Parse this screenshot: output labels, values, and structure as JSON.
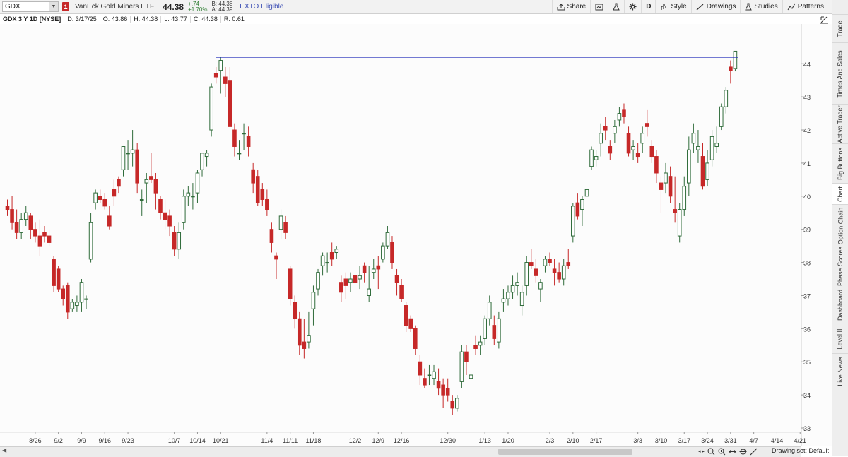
{
  "header": {
    "symbol": "GDX",
    "flag": "1",
    "description": "VanEck Gold Miners ETF",
    "price": "44.38",
    "change": "+.74",
    "change_pct": "+1.70%",
    "bid": "B: 44.38",
    "ask": "A: 44.39",
    "exto": "EXTO Eligible"
  },
  "toolbar": {
    "share": "Share",
    "period": "D",
    "style": "Style",
    "drawings": "Drawings",
    "studies": "Studies",
    "patterns": "Patterns"
  },
  "infobar": {
    "symbol": "GDX 3 Y 1D [NYSE]",
    "date": "D: 3/17/25",
    "open": "O: 43.86",
    "high": "H: 44.38",
    "low": "L: 43.77",
    "close": "C: 44.38",
    "range": "R: 0.61"
  },
  "right_tabs": [
    "Trade",
    "Times And Sales",
    "Active Trader",
    "Big Buttons",
    "Chart",
    "Option Chain",
    "Phase Scores",
    "Dashboard",
    "Level II",
    "Live News"
  ],
  "active_tab": "Chart",
  "bottom": {
    "drawing_set": "Drawing set: Default"
  },
  "colors": {
    "up": "#2f6b3a",
    "down": "#c62828",
    "hline": "#1f2bb8",
    "accent": "#3f51b5"
  },
  "chart_data": {
    "type": "candlestick",
    "ylim": [
      33,
      45.2
    ],
    "y_ticks": [
      33,
      34,
      35,
      36,
      37,
      38,
      39,
      40,
      41,
      42,
      43,
      44
    ],
    "x_ticks": [
      {
        "label": "8/26",
        "i": 6
      },
      {
        "label": "9/2",
        "i": 11
      },
      {
        "label": "9/9",
        "i": 16
      },
      {
        "label": "9/16",
        "i": 21
      },
      {
        "label": "9/23",
        "i": 26
      },
      {
        "label": "10/7",
        "i": 36
      },
      {
        "label": "10/14",
        "i": 41
      },
      {
        "label": "10/21",
        "i": 46
      },
      {
        "label": "11/4",
        "i": 56
      },
      {
        "label": "11/11",
        "i": 61
      },
      {
        "label": "11/18",
        "i": 66
      },
      {
        "label": "12/2",
        "i": 75
      },
      {
        "label": "12/9",
        "i": 80
      },
      {
        "label": "12/16",
        "i": 85
      },
      {
        "label": "12/30",
        "i": 95
      },
      {
        "label": "1/13",
        "i": 103
      },
      {
        "label": "1/20",
        "i": 108
      },
      {
        "label": "2/3",
        "i": 117
      },
      {
        "label": "2/10",
        "i": 122
      },
      {
        "label": "2/17",
        "i": 127
      },
      {
        "label": "3/3",
        "i": 136
      },
      {
        "label": "3/10",
        "i": 141
      },
      {
        "label": "3/17",
        "i": 146
      },
      {
        "label": "3/24",
        "i": 151
      },
      {
        "label": "3/31",
        "i": 156
      },
      {
        "label": "4/7",
        "i": 161
      },
      {
        "label": "4/14",
        "i": 166
      },
      {
        "label": "4/21",
        "i": 171
      }
    ],
    "hline": 44.2,
    "candles": [
      [
        39.7,
        39.9,
        39.4,
        39.6
      ],
      [
        39.6,
        40.0,
        39.0,
        39.2
      ],
      [
        39.2,
        39.6,
        38.7,
        38.9
      ],
      [
        38.9,
        39.5,
        38.7,
        39.3
      ],
      [
        39.3,
        39.7,
        39.1,
        39.5
      ],
      [
        39.4,
        39.5,
        38.7,
        39.0
      ],
      [
        39.0,
        39.2,
        38.6,
        38.8
      ],
      [
        38.8,
        39.3,
        38.2,
        38.5
      ],
      [
        38.9,
        39.1,
        38.6,
        38.8
      ],
      [
        38.8,
        39.0,
        38.5,
        38.6
      ],
      [
        38.1,
        38.2,
        37.1,
        37.3
      ],
      [
        37.8,
        37.9,
        37.1,
        37.2
      ],
      [
        37.2,
        37.3,
        36.7,
        36.9
      ],
      [
        37.3,
        37.4,
        36.3,
        36.5
      ],
      [
        36.6,
        36.9,
        36.5,
        36.8
      ],
      [
        36.7,
        37.0,
        36.5,
        36.8
      ],
      [
        36.8,
        37.5,
        36.5,
        37.4
      ],
      [
        36.9,
        37.0,
        36.6,
        36.9
      ],
      [
        38.1,
        39.5,
        38.0,
        39.2
      ],
      [
        39.8,
        40.2,
        39.6,
        40.1
      ],
      [
        40.0,
        40.2,
        39.8,
        39.9
      ],
      [
        39.9,
        40.1,
        39.6,
        39.7
      ],
      [
        39.4,
        39.7,
        39.0,
        39.1
      ],
      [
        40.2,
        40.5,
        39.7,
        40.0
      ],
      [
        40.5,
        40.6,
        40.1,
        40.3
      ],
      [
        40.8,
        41.5,
        40.6,
        41.5
      ],
      [
        41.3,
        41.7,
        40.8,
        41.3
      ],
      [
        41.3,
        42.0,
        40.9,
        41.4
      ],
      [
        41.4,
        41.6,
        40.1,
        40.4
      ],
      [
        39.9,
        40.2,
        39.4,
        39.9
      ],
      [
        40.4,
        40.7,
        39.8,
        40.5
      ],
      [
        40.6,
        41.3,
        40.4,
        40.5
      ],
      [
        40.5,
        40.7,
        39.6,
        40.1
      ],
      [
        39.9,
        40.0,
        39.3,
        39.5
      ],
      [
        39.5,
        39.9,
        39.0,
        39.3
      ],
      [
        39.4,
        39.6,
        38.8,
        39.1
      ],
      [
        38.9,
        39.1,
        38.2,
        38.4
      ],
      [
        38.4,
        39.2,
        38.1,
        38.9
      ],
      [
        39.2,
        40.2,
        39.0,
        40.0
      ],
      [
        40.0,
        40.3,
        39.7,
        40.1
      ],
      [
        40.0,
        40.4,
        39.6,
        40.0
      ],
      [
        40.1,
        40.8,
        39.8,
        40.7
      ],
      [
        40.8,
        41.3,
        40.6,
        41.3
      ],
      [
        41.2,
        41.4,
        40.9,
        41.3
      ],
      [
        42.0,
        43.4,
        41.8,
        43.3
      ],
      [
        43.7,
        43.9,
        43.4,
        43.6
      ],
      [
        43.8,
        44.2,
        43.1,
        44.1
      ],
      [
        43.6,
        43.9,
        43.0,
        43.4
      ],
      [
        43.5,
        43.9,
        42.6,
        42.1
      ],
      [
        42.0,
        42.2,
        41.2,
        41.5
      ],
      [
        41.3,
        41.7,
        41.1,
        41.3
      ],
      [
        41.9,
        42.2,
        41.4,
        41.9
      ],
      [
        41.8,
        42.1,
        41.2,
        41.5
      ],
      [
        40.8,
        41.0,
        40.1,
        40.4
      ],
      [
        40.6,
        40.8,
        39.7,
        39.8
      ],
      [
        40.2,
        40.4,
        39.7,
        39.9
      ],
      [
        39.9,
        40.2,
        39.4,
        39.6
      ],
      [
        39.0,
        39.2,
        38.3,
        38.6
      ],
      [
        38.2,
        38.3,
        37.5,
        38.1
      ],
      [
        39.0,
        39.6,
        38.7,
        39.4
      ],
      [
        39.2,
        39.4,
        38.7,
        38.9
      ],
      [
        37.8,
        37.9,
        36.7,
        36.9
      ],
      [
        36.8,
        37.0,
        36.0,
        36.3
      ],
      [
        36.3,
        36.5,
        35.2,
        35.5
      ],
      [
        35.6,
        36.3,
        35.1,
        35.4
      ],
      [
        35.6,
        36.5,
        35.4,
        35.8
      ],
      [
        36.6,
        37.3,
        36.1,
        37.1
      ],
      [
        37.2,
        37.8,
        37.0,
        37.7
      ],
      [
        37.9,
        38.3,
        37.6,
        38.2
      ],
      [
        38.0,
        38.3,
        37.7,
        38.0
      ],
      [
        38.3,
        38.6,
        37.9,
        38.1
      ],
      [
        38.3,
        38.5,
        38.1,
        38.4
      ],
      [
        37.4,
        37.6,
        36.8,
        37.1
      ],
      [
        37.5,
        37.7,
        36.9,
        37.3
      ],
      [
        37.4,
        37.7,
        37.1,
        37.5
      ],
      [
        37.6,
        37.8,
        37.0,
        37.4
      ],
      [
        37.5,
        37.9,
        37.2,
        37.6
      ],
      [
        37.9,
        38.0,
        37.4,
        37.7
      ],
      [
        37.0,
        37.9,
        36.8,
        37.2
      ],
      [
        37.7,
        38.1,
        37.5,
        37.8
      ],
      [
        37.9,
        38.2,
        37.2,
        37.8
      ],
      [
        38.1,
        38.6,
        38.0,
        38.5
      ],
      [
        38.5,
        39.1,
        38.4,
        38.9
      ],
      [
        38.6,
        38.8,
        37.8,
        38.0
      ],
      [
        37.6,
        37.8,
        37.0,
        37.4
      ],
      [
        37.3,
        37.5,
        36.8,
        36.9
      ],
      [
        36.7,
        36.8,
        35.9,
        36.1
      ],
      [
        36.3,
        36.4,
        35.9,
        36.0
      ],
      [
        36.0,
        36.1,
        35.2,
        35.4
      ],
      [
        35.0,
        35.2,
        34.3,
        34.6
      ],
      [
        34.5,
        34.8,
        34.2,
        34.3
      ],
      [
        34.6,
        34.9,
        34.3,
        34.6
      ],
      [
        34.5,
        34.9,
        34.3,
        34.7
      ],
      [
        34.4,
        34.8,
        34.0,
        34.2
      ],
      [
        34.3,
        34.5,
        33.6,
        34.0
      ],
      [
        34.2,
        34.5,
        33.8,
        34.0
      ],
      [
        33.8,
        34.0,
        33.4,
        33.6
      ],
      [
        33.6,
        34.0,
        33.5,
        33.9
      ],
      [
        34.4,
        35.5,
        34.2,
        35.3
      ],
      [
        35.3,
        35.5,
        34.6,
        35.0
      ],
      [
        34.5,
        34.7,
        34.3,
        34.6
      ],
      [
        35.5,
        35.8,
        35.2,
        35.4
      ],
      [
        35.5,
        35.8,
        35.2,
        35.6
      ],
      [
        35.7,
        36.4,
        35.5,
        36.3
      ],
      [
        36.3,
        37.0,
        36.1,
        36.8
      ],
      [
        36.1,
        36.4,
        35.5,
        35.7
      ],
      [
        35.6,
        36.5,
        35.4,
        36.3
      ],
      [
        36.8,
        37.2,
        36.5,
        36.9
      ],
      [
        36.9,
        37.3,
        36.7,
        37.1
      ],
      [
        37.1,
        37.6,
        36.9,
        37.3
      ],
      [
        37.3,
        37.7,
        37.0,
        37.4
      ],
      [
        36.7,
        37.3,
        36.4,
        37.1
      ],
      [
        37.3,
        38.2,
        37.0,
        38.0
      ],
      [
        38.0,
        38.4,
        37.8,
        37.9
      ],
      [
        37.8,
        38.1,
        37.4,
        37.6
      ],
      [
        37.2,
        37.5,
        36.8,
        37.4
      ],
      [
        37.9,
        38.2,
        37.7,
        38.1
      ],
      [
        38.1,
        38.3,
        37.9,
        38.0
      ],
      [
        37.8,
        38.1,
        37.3,
        37.7
      ],
      [
        37.7,
        38.0,
        37.4,
        37.5
      ],
      [
        37.5,
        38.1,
        37.3,
        37.9
      ],
      [
        38.0,
        38.4,
        37.8,
        37.9
      ],
      [
        38.8,
        39.8,
        38.6,
        39.7
      ],
      [
        39.8,
        40.1,
        39.3,
        39.4
      ],
      [
        39.6,
        40.0,
        39.1,
        39.9
      ],
      [
        40.0,
        40.3,
        39.7,
        40.2
      ],
      [
        40.9,
        41.5,
        40.8,
        41.4
      ],
      [
        41.1,
        41.4,
        40.9,
        41.2
      ],
      [
        41.6,
        42.2,
        41.2,
        41.9
      ],
      [
        42.1,
        42.4,
        41.7,
        42.0
      ],
      [
        41.5,
        41.7,
        41.1,
        41.3
      ],
      [
        41.9,
        42.3,
        41.6,
        42.1
      ],
      [
        42.3,
        42.7,
        42.1,
        42.5
      ],
      [
        42.6,
        42.8,
        42.2,
        42.4
      ],
      [
        41.9,
        42.1,
        41.2,
        41.3
      ],
      [
        41.4,
        41.7,
        41.1,
        41.5
      ],
      [
        41.3,
        41.6,
        41.0,
        41.2
      ],
      [
        41.6,
        42.1,
        41.3,
        41.9
      ],
      [
        42.2,
        42.6,
        41.8,
        42.1
      ],
      [
        41.5,
        41.7,
        41.0,
        41.2
      ],
      [
        41.2,
        41.4,
        40.4,
        40.7
      ],
      [
        40.4,
        40.6,
        39.5,
        40.2
      ],
      [
        40.4,
        41.0,
        40.1,
        40.7
      ],
      [
        40.6,
        40.9,
        39.8,
        40.0
      ],
      [
        39.6,
        40.6,
        39.2,
        39.5
      ],
      [
        38.8,
        39.8,
        38.6,
        39.6
      ],
      [
        39.6,
        40.6,
        39.4,
        40.3
      ],
      [
        40.4,
        41.8,
        40.0,
        41.4
      ],
      [
        41.6,
        42.2,
        41.3,
        41.9
      ],
      [
        41.4,
        42.0,
        41.0,
        41.5
      ],
      [
        41.2,
        41.6,
        40.2,
        40.3
      ],
      [
        40.5,
        41.4,
        40.3,
        41.0
      ],
      [
        41.1,
        42.0,
        40.9,
        41.8
      ],
      [
        41.5,
        42.1,
        41.3,
        41.6
      ],
      [
        42.1,
        42.8,
        42.0,
        42.7
      ],
      [
        42.7,
        43.3,
        42.5,
        43.2
      ],
      [
        43.9,
        44.1,
        43.4,
        43.8
      ],
      [
        43.86,
        44.38,
        43.77,
        44.38
      ]
    ]
  }
}
